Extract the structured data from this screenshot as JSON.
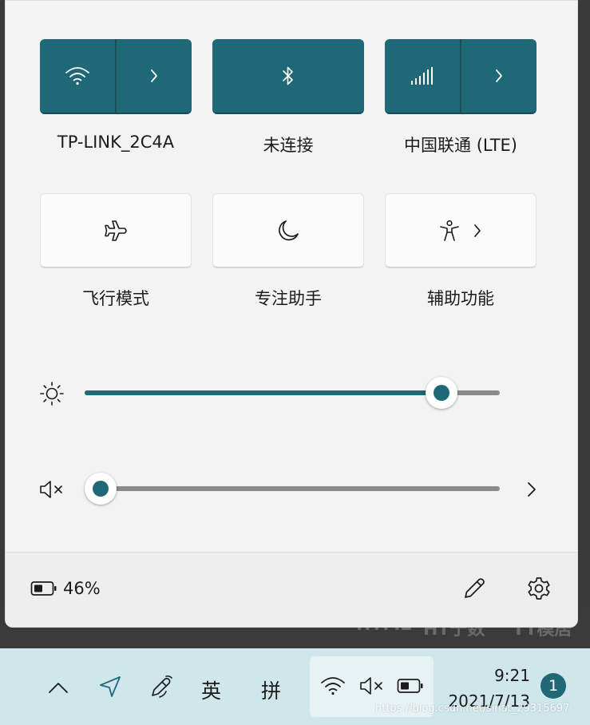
{
  "background_app": {
    "ghost_texts": [
      "HTML",
      "HT于数",
      "TT模居"
    ]
  },
  "quick_settings": {
    "tiles": [
      {
        "id": "wifi",
        "label": "TP-LINK_2C4A",
        "active": true,
        "icon": "wifi-icon",
        "has_expand": true
      },
      {
        "id": "bluetooth",
        "label": "未连接",
        "active": true,
        "icon": "bluetooth-icon",
        "has_expand": false
      },
      {
        "id": "cellular",
        "label": "中国联通 (LTE)",
        "active": true,
        "icon": "cellular-signal-icon",
        "has_expand": true
      },
      {
        "id": "airplane",
        "label": "飞行模式",
        "active": false,
        "icon": "airplane-icon",
        "has_expand": false
      },
      {
        "id": "focus",
        "label": "专注助手",
        "active": false,
        "icon": "moon-icon",
        "has_expand": false
      },
      {
        "id": "accessibility",
        "label": "辅助功能",
        "active": false,
        "icon": "accessibility-icon",
        "has_expand": true
      }
    ],
    "brightness": {
      "icon": "brightness-icon",
      "value": 0.86
    },
    "volume": {
      "icon": "volume-muted-icon",
      "value": 0.0,
      "expand_icon": "chevron-right-icon"
    },
    "footer": {
      "battery_icon": "battery-icon",
      "battery_percent": "46%",
      "edit_icon": "pencil-icon",
      "settings_icon": "gear-icon"
    }
  },
  "taskbar": {
    "overflow_icon": "chevron-up-icon",
    "location_icon": "location-arrow-icon",
    "pen_icon": "pen-icon",
    "ime_lang": "英",
    "ime_mode": "拼",
    "tray_icons": [
      "wifi-icon",
      "volume-muted-icon",
      "battery-icon"
    ],
    "time": "9:21",
    "date": "2021/7/13",
    "notification_count": "1"
  },
  "watermark": "https://blog.csdn.net/sinat_29315697",
  "colors": {
    "accent": "#1f6877",
    "panel_bg": "#f3f3f3",
    "taskbar_bg": "#cfe6ea"
  }
}
